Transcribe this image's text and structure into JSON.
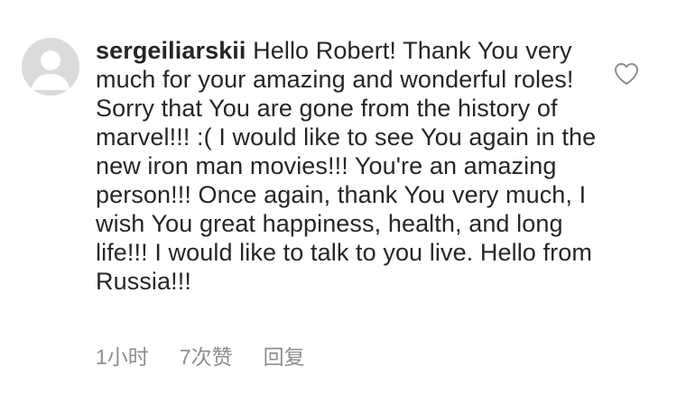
{
  "comment": {
    "username": "sergeiliarskii",
    "text": "Hello Robert! Thank You very much for your amazing and wonderful roles! Sorry that You are gone from the history of marvel!!! :( I would like to see You again in the new iron man movies!!! You're an amazing person!!! Once again, thank You very much, I wish You great happiness, health, and long life!!! I would like to talk to you live. Hello from Russia!!!",
    "time": "1小时",
    "likes": "7次赞",
    "reply_label": "回复",
    "avatar_icon": "default-avatar-icon",
    "like_icon": "heart-outline-icon"
  },
  "colors": {
    "text": "#262626",
    "meta": "#8e8e8e",
    "avatar_bg": "#dbdbdb",
    "avatar_fg": "#ffffff"
  }
}
